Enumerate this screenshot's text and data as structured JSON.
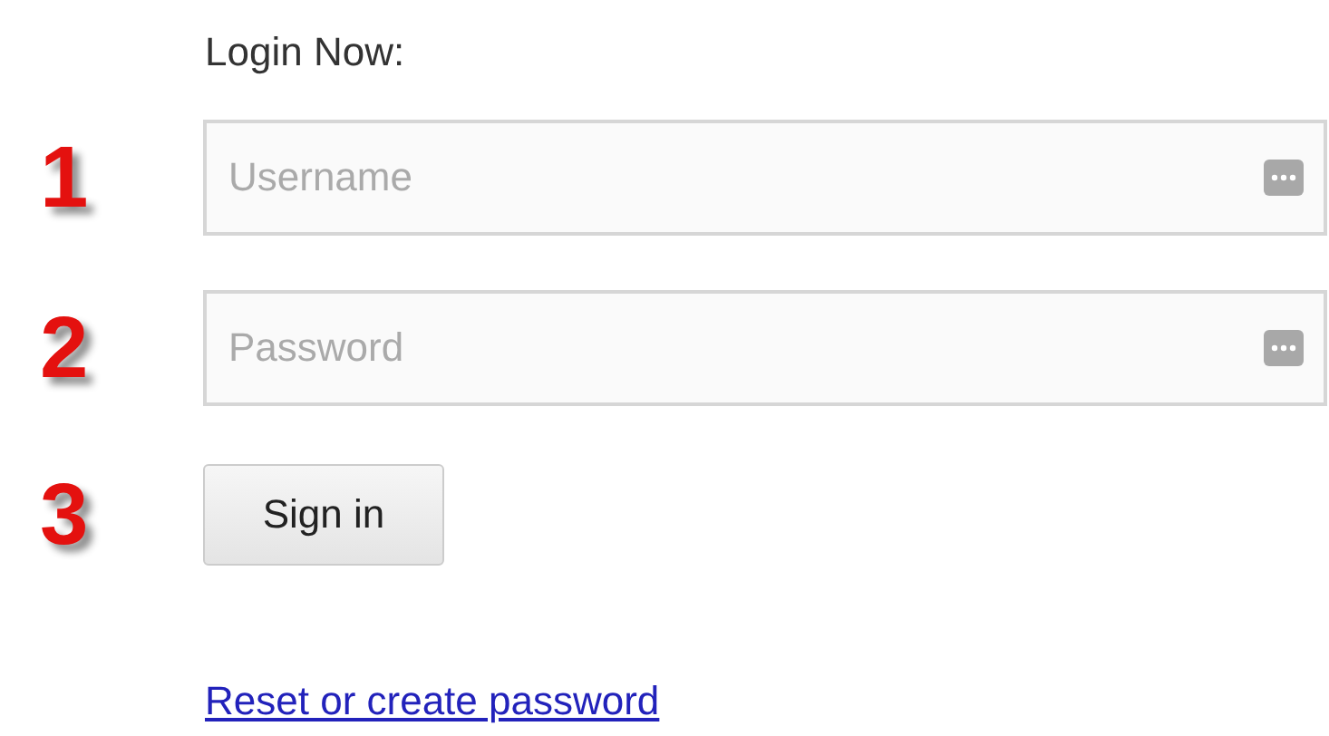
{
  "heading": "Login Now:",
  "steps": [
    {
      "number": "1",
      "kind": "field",
      "placeholder": "Username"
    },
    {
      "number": "2",
      "kind": "field",
      "placeholder": "Password"
    },
    {
      "number": "3",
      "kind": "button",
      "label": "Sign in"
    }
  ],
  "link": "Reset or create password"
}
